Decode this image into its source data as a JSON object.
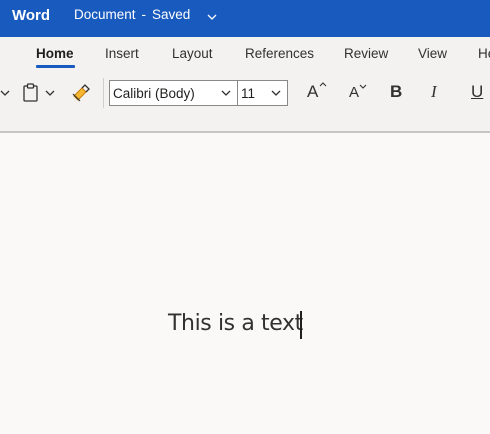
{
  "titlebar": {
    "app_name": "Word",
    "doc_name": "Document",
    "separator": "-",
    "status": "Saved",
    "bg_color": "#185abd"
  },
  "tabs": [
    {
      "label": "Home",
      "active": true
    },
    {
      "label": "Insert"
    },
    {
      "label": "Layout"
    },
    {
      "label": "References"
    },
    {
      "label": "Review"
    },
    {
      "label": "View"
    },
    {
      "label": "He"
    }
  ],
  "toolbar": {
    "font_name": "Calibri (Body)",
    "font_size": "11",
    "grow_font": "A",
    "shrink_font": "A",
    "bold": "B",
    "italic": "I",
    "underline": "U"
  },
  "document": {
    "text": "This is a text"
  },
  "icons": [
    "chevron-down-icon",
    "clipboard-icon",
    "format-painter-icon"
  ]
}
